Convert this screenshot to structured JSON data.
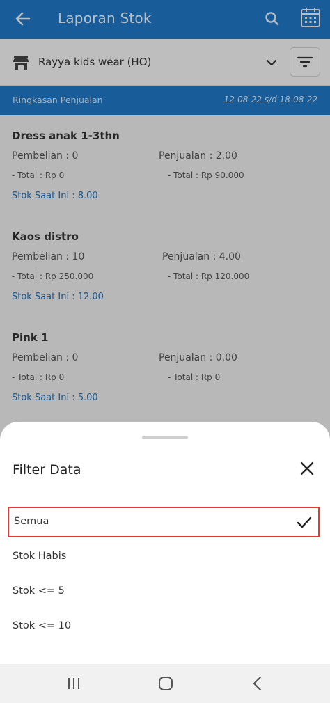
{
  "app_bar": {
    "title": "Laporan Stok",
    "color": "#1f78c6",
    "icons": [
      "back-arrow-icon",
      "search-icon",
      "calendar-icon"
    ]
  },
  "store_selector": {
    "store_name": "Rayya kids wear (HO)",
    "icons": [
      "store-icon",
      "chevron-down-icon",
      "filter-icon"
    ]
  },
  "summary_bar": {
    "label": "Ringkasan Penjualan",
    "date_range": "12-08-22 s/d 18-08-22"
  },
  "products": [
    {
      "name": "Dress anak 1-3thn",
      "purchase": "Pembelian : 0",
      "sale": "Penjualan : 2.00",
      "purchase_total": "- Total : Rp 0",
      "sale_total": "- Total : Rp 90.000",
      "stock": "Stok Saat Ini : 8.00"
    },
    {
      "name": "Kaos distro",
      "purchase": "Pembelian : 10",
      "sale": "Penjualan : 4.00",
      "purchase_total": "- Total : Rp 250.000",
      "sale_total": "- Total : Rp 120.000",
      "stock": "Stok Saat Ini : 12.00"
    },
    {
      "name": "Pink 1",
      "purchase": "Pembelian : 0",
      "sale": "Penjualan : 0.00",
      "purchase_total": "- Total : Rp 0",
      "sale_total": "- Total : Rp 0",
      "stock": "Stok Saat Ini : 5.00"
    }
  ],
  "filter_sheet": {
    "title": "Filter Data",
    "options": [
      {
        "label": "Semua",
        "selected": true
      },
      {
        "label": "Stok Habis",
        "selected": false
      },
      {
        "label": "Stok <= 5",
        "selected": false
      },
      {
        "label": "Stok <= 10",
        "selected": false
      }
    ],
    "highlight_color": "#e53935",
    "icons": [
      "close-icon",
      "checkmark-icon"
    ]
  },
  "system_nav": {
    "icons": [
      "recent-apps-icon",
      "home-icon",
      "back-icon"
    ]
  }
}
